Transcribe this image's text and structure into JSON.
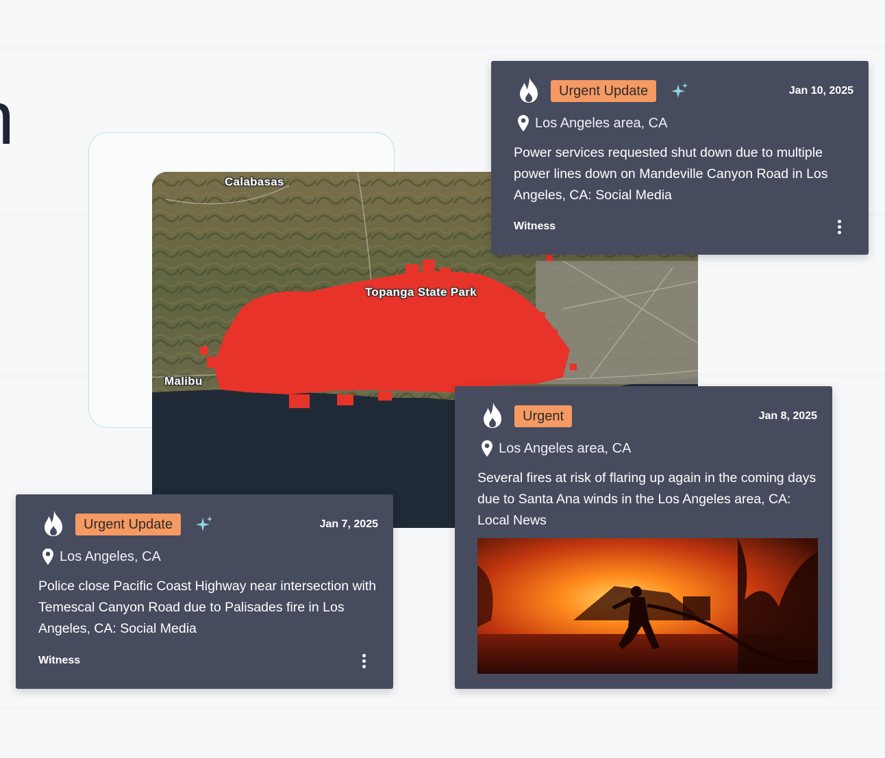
{
  "hero": {
    "glyph": "n"
  },
  "map": {
    "labels": {
      "calabasas": "Calabasas",
      "topanga": "Topanga State Park",
      "malibu": "Malibu"
    },
    "colors": {
      "fire": "#e8332a",
      "ocean": "#1f2a36",
      "land": "#6e6a48"
    }
  },
  "cards": [
    {
      "badge": "Urgent Update",
      "date": "Jan 10, 2025",
      "location": "Los Angeles area, CA",
      "text": "Power services requested shut down due to multiple power lines down on Mandeville Canyon Road in Los Angeles, CA: Social Media",
      "source": "Witness"
    },
    {
      "badge": "Urgent",
      "date": "Jan 8, 2025",
      "location": "Los Angeles area, CA",
      "text": "Several fires at risk of flaring up again in the coming days due to Santa Ana winds in the Los Angeles area, CA: Local News"
    },
    {
      "badge": "Urgent Update",
      "date": "Jan 7, 2025",
      "location": "Los Angeles, CA",
      "text": "Police close Pacific Coast Highway near intersection with Temescal Canyon Road due to Palisades fire in Los Angeles, CA: Social Media",
      "source": "Witness"
    }
  ],
  "colors": {
    "card_bg": "#474b5e",
    "badge_bg": "#f59a63",
    "sparkle": "#8fd6e3",
    "outline": "#b9e3e0"
  },
  "icons": {
    "flame": "flame-icon",
    "sparkle": "sparkle-icon",
    "pin": "map-pin-icon",
    "more": "more-vertical-icon"
  }
}
